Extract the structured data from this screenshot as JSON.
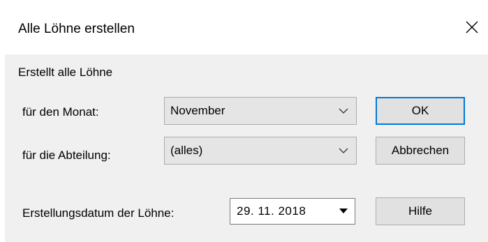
{
  "window": {
    "title": "Alle Löhne erstellen",
    "close_icon": "close-icon"
  },
  "intro_text": "Erstellt alle Löhne",
  "month": {
    "label": "für den Monat:",
    "selected": "November",
    "icon": "chevron-down-icon"
  },
  "department": {
    "label": "für die Abteilung:",
    "selected": "(alles)",
    "icon": "chevron-down-icon"
  },
  "creation_date": {
    "label": "Erstellungsdatum der Löhne:",
    "value": "29. 11. 2018",
    "icon": "dropdown-arrow-icon"
  },
  "buttons": {
    "ok": "OK",
    "cancel": "Abbrechen",
    "help": "Hilfe"
  },
  "colors": {
    "default_button_border": "#0078d7",
    "client_background": "#f0f0f0",
    "combo_background": "#e5e5e5",
    "button_background": "#e1e1e1"
  }
}
